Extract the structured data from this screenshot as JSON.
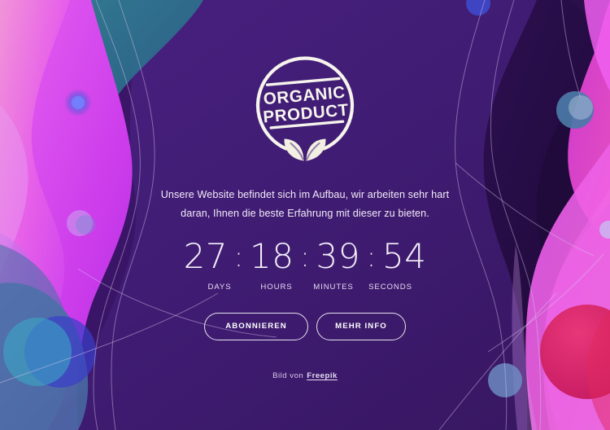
{
  "page": {
    "background_color": "#3c1b6c",
    "accent_color": "#ffffff"
  },
  "logo": {
    "name": "organic-product-badge",
    "line1": "ORGANIC",
    "line2": "PRODUCT",
    "mark": "leaves-icon",
    "color": "#f4f2e8"
  },
  "lead": {
    "line1": "Unsere Website befindet sich im Aufbau, wir arbeiten sehr hart",
    "line2": "daran, Ihnen die beste Erfahrung mit dieser zu bieten."
  },
  "countdown": {
    "separator": ":",
    "units": [
      {
        "value": "27",
        "label": "DAYS"
      },
      {
        "value": "18",
        "label": "HOURS"
      },
      {
        "value": "39",
        "label": "MINUTES"
      },
      {
        "value": "54",
        "label": "SECONDS"
      }
    ]
  },
  "buttons": {
    "subscribe_label": "ABONNIEREN",
    "more_info_label": "MEHR INFO"
  },
  "credit": {
    "prefix": "Bild von",
    "link_label": "Freepik"
  }
}
